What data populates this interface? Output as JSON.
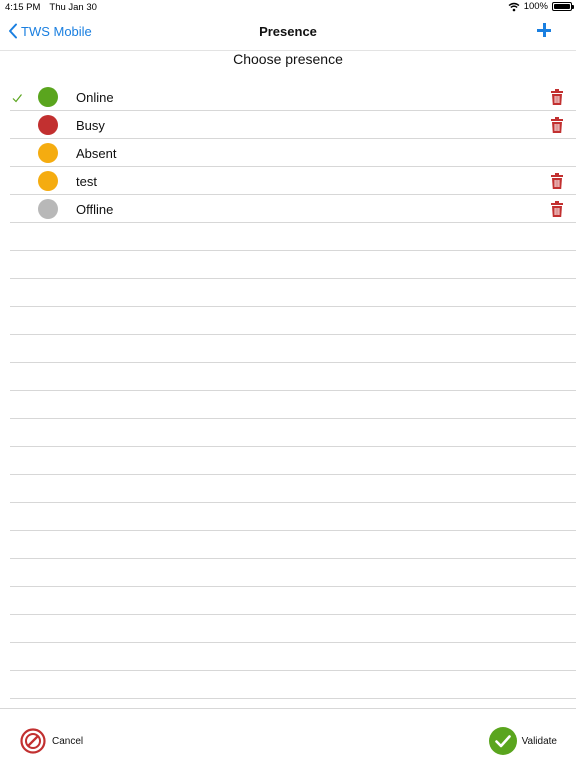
{
  "status_bar": {
    "time": "4:15 PM",
    "date": "Thu Jan 30",
    "battery": "100%"
  },
  "nav": {
    "back_label": "TWS Mobile",
    "title": "Presence"
  },
  "subtitle": "Choose presence",
  "presences": [
    {
      "label": "Online",
      "color": "#5aa51e",
      "selected": true,
      "deletable": true
    },
    {
      "label": "Busy",
      "color": "#c23030",
      "selected": false,
      "deletable": true
    },
    {
      "label": "Absent",
      "color": "#f5ac10",
      "selected": false,
      "deletable": false
    },
    {
      "label": "test",
      "color": "#f5ac10",
      "selected": false,
      "deletable": true
    },
    {
      "label": "Offline",
      "color": "#b8b8b8",
      "selected": false,
      "deletable": true
    }
  ],
  "footer": {
    "cancel_label": "Cancel",
    "validate_label": "Validate"
  },
  "colors": {
    "accent": "#1a7fe0",
    "delete": "#c23030",
    "validate": "#5aa51e",
    "cancel": "#c23030",
    "check": "#5aa51e"
  }
}
